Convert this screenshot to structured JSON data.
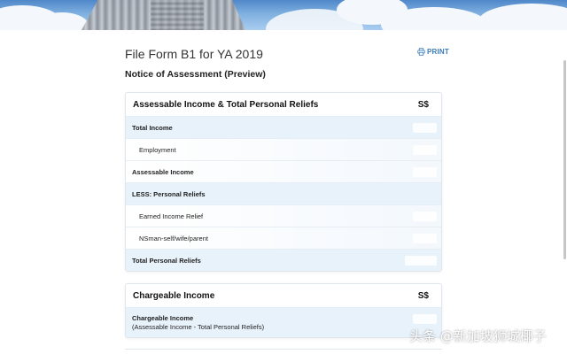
{
  "page": {
    "title": "File Form B1 for YA 2019",
    "print_label": "PRINT",
    "subtitle": "Notice of Assessment (Preview)"
  },
  "cards": {
    "income_reliefs": {
      "title": "Assessable Income & Total Personal Reliefs",
      "currency": "S$",
      "rows": {
        "total_income": "Total Income",
        "employment": "Employment",
        "assessable_income": "Assessable Income",
        "less_personal_reliefs": "LESS: Personal Reliefs",
        "earned_income_relief": "Earned Income Relief",
        "nsman_relief": "NSman-self/wife/parent",
        "total_personal_reliefs": "Total Personal Reliefs"
      }
    },
    "chargeable": {
      "title": "Chargeable Income",
      "currency": "S$",
      "row_label": "Chargeable Income",
      "row_sublabel": "(Assessable Income - Total Personal Reliefs)"
    }
  },
  "watermark": "头条 @新加坡狮城椰子",
  "icons": {
    "print": "print-icon"
  },
  "colors": {
    "link": "#3a7bb8",
    "row_highlight": "#e8f2fb",
    "border": "#dfe6ee"
  }
}
